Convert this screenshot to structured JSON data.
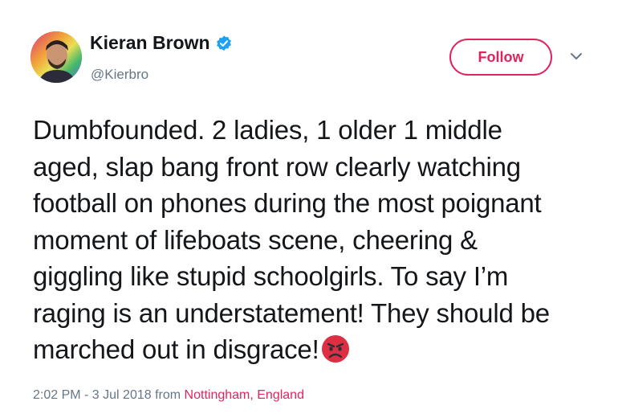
{
  "author": {
    "name": "Kieran Brown",
    "handle": "@Kierbro",
    "verified": true
  },
  "actions": {
    "follow_label": "Follow"
  },
  "tweet": {
    "lines": [
      "Dumbfounded. 2 ladies, 1 older 1 middle",
      "aged, slap bang front row clearly watching",
      "football on phones during the most poignant",
      "moment of lifeboats scene, cheering &",
      "giggling like stupid schoolgirls. To say I’m",
      "raging is an understatement! They should be",
      "marched out in disgrace!"
    ],
    "emoji": "angry-face"
  },
  "meta": {
    "timestamp": "2:02 PM - 3 Jul 2018",
    "from_word": "from",
    "location": "Nottingham, England"
  },
  "colors": {
    "accent": "#e0245e",
    "verified": "#1da1f2",
    "secondary_text": "#657786",
    "primary_text": "#14171a"
  }
}
